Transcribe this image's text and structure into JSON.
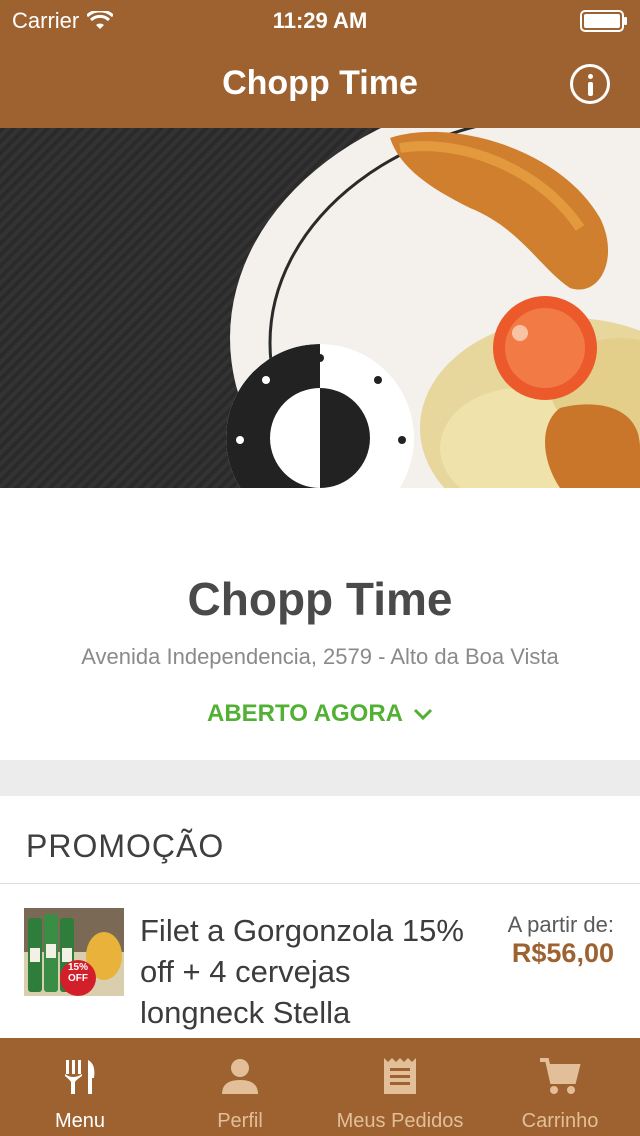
{
  "status_bar": {
    "carrier": "Carrier",
    "time": "11:29 AM"
  },
  "nav": {
    "title": "Chopp Time"
  },
  "restaurant": {
    "name": "Chopp Time",
    "address": "Avenida Independencia, 2579 - Alto da Boa Vista",
    "status": "ABERTO AGORA"
  },
  "promo_section": {
    "header": "PROMOÇÃO",
    "items": [
      {
        "title": "Filet a Gorgonzola 15% off + 4 cervejas longneck Stella",
        "price_label": "A partir de:",
        "price": "R$56,00",
        "badge": "15% OFF"
      }
    ]
  },
  "tabs": [
    {
      "label": "Menu",
      "icon": "utensils-icon",
      "active": true
    },
    {
      "label": "Perfil",
      "icon": "person-icon",
      "active": false
    },
    {
      "label": "Meus Pedidos",
      "icon": "receipt-icon",
      "active": false
    },
    {
      "label": "Carrinho",
      "icon": "cart-icon",
      "active": false
    }
  ],
  "colors": {
    "brand": "#9d6230",
    "open_green": "#52b034",
    "tab_inactive": "#e2bf98"
  }
}
